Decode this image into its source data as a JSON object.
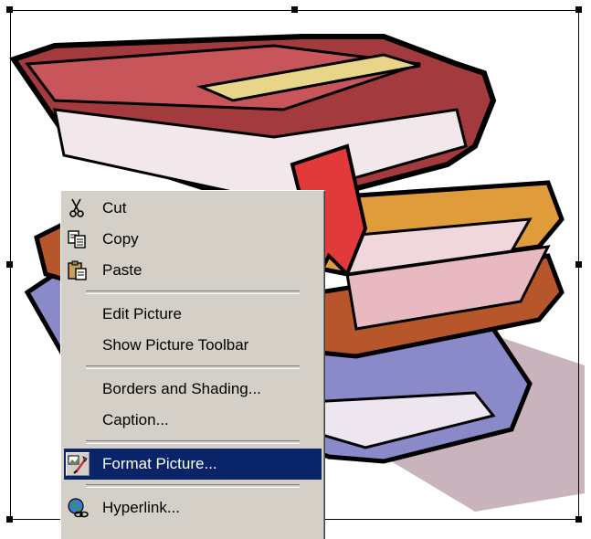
{
  "colors": {
    "menu_background": "#d4d0c8",
    "menu_selected": "#0a246a",
    "menu_selected_text": "#ffffff"
  },
  "picture": {
    "subject": "stack-of-books-clipart",
    "selected": true
  },
  "context_menu": {
    "items": [
      {
        "label": "Cut",
        "icon": "scissors-icon"
      },
      {
        "label": "Copy",
        "icon": "copy-icon"
      },
      {
        "label": "Paste",
        "icon": "paste-icon"
      },
      {
        "label": "Edit Picture"
      },
      {
        "label": "Show Picture Toolbar"
      },
      {
        "label": "Borders and Shading..."
      },
      {
        "label": "Caption..."
      },
      {
        "label": "Format Picture...",
        "icon": "format-picture-icon",
        "selected": true
      },
      {
        "label": "Hyperlink...",
        "icon": "hyperlink-globe-icon"
      }
    ]
  }
}
